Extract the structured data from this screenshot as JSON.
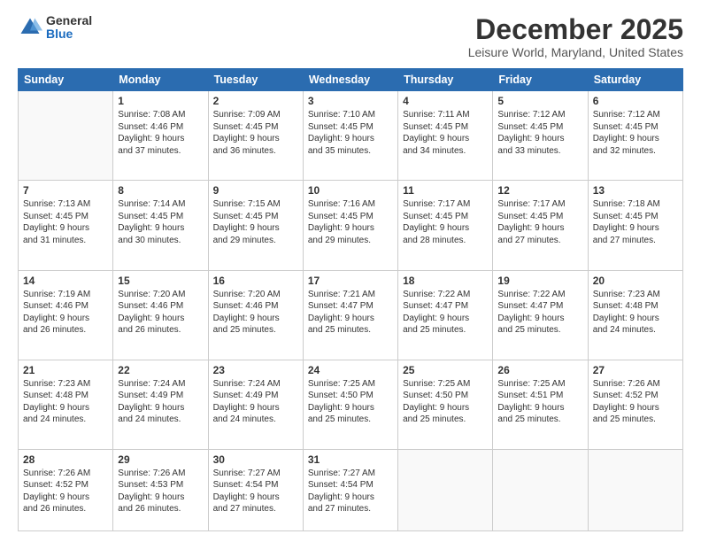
{
  "logo": {
    "general": "General",
    "blue": "Blue"
  },
  "header": {
    "month": "December 2025",
    "location": "Leisure World, Maryland, United States"
  },
  "weekdays": [
    "Sunday",
    "Monday",
    "Tuesday",
    "Wednesday",
    "Thursday",
    "Friday",
    "Saturday"
  ],
  "weeks": [
    [
      {
        "day": "",
        "info": ""
      },
      {
        "day": "1",
        "info": "Sunrise: 7:08 AM\nSunset: 4:46 PM\nDaylight: 9 hours\nand 37 minutes."
      },
      {
        "day": "2",
        "info": "Sunrise: 7:09 AM\nSunset: 4:45 PM\nDaylight: 9 hours\nand 36 minutes."
      },
      {
        "day": "3",
        "info": "Sunrise: 7:10 AM\nSunset: 4:45 PM\nDaylight: 9 hours\nand 35 minutes."
      },
      {
        "day": "4",
        "info": "Sunrise: 7:11 AM\nSunset: 4:45 PM\nDaylight: 9 hours\nand 34 minutes."
      },
      {
        "day": "5",
        "info": "Sunrise: 7:12 AM\nSunset: 4:45 PM\nDaylight: 9 hours\nand 33 minutes."
      },
      {
        "day": "6",
        "info": "Sunrise: 7:12 AM\nSunset: 4:45 PM\nDaylight: 9 hours\nand 32 minutes."
      }
    ],
    [
      {
        "day": "7",
        "info": "Sunrise: 7:13 AM\nSunset: 4:45 PM\nDaylight: 9 hours\nand 31 minutes."
      },
      {
        "day": "8",
        "info": "Sunrise: 7:14 AM\nSunset: 4:45 PM\nDaylight: 9 hours\nand 30 minutes."
      },
      {
        "day": "9",
        "info": "Sunrise: 7:15 AM\nSunset: 4:45 PM\nDaylight: 9 hours\nand 29 minutes."
      },
      {
        "day": "10",
        "info": "Sunrise: 7:16 AM\nSunset: 4:45 PM\nDaylight: 9 hours\nand 29 minutes."
      },
      {
        "day": "11",
        "info": "Sunrise: 7:17 AM\nSunset: 4:45 PM\nDaylight: 9 hours\nand 28 minutes."
      },
      {
        "day": "12",
        "info": "Sunrise: 7:17 AM\nSunset: 4:45 PM\nDaylight: 9 hours\nand 27 minutes."
      },
      {
        "day": "13",
        "info": "Sunrise: 7:18 AM\nSunset: 4:45 PM\nDaylight: 9 hours\nand 27 minutes."
      }
    ],
    [
      {
        "day": "14",
        "info": "Sunrise: 7:19 AM\nSunset: 4:46 PM\nDaylight: 9 hours\nand 26 minutes."
      },
      {
        "day": "15",
        "info": "Sunrise: 7:20 AM\nSunset: 4:46 PM\nDaylight: 9 hours\nand 26 minutes."
      },
      {
        "day": "16",
        "info": "Sunrise: 7:20 AM\nSunset: 4:46 PM\nDaylight: 9 hours\nand 25 minutes."
      },
      {
        "day": "17",
        "info": "Sunrise: 7:21 AM\nSunset: 4:47 PM\nDaylight: 9 hours\nand 25 minutes."
      },
      {
        "day": "18",
        "info": "Sunrise: 7:22 AM\nSunset: 4:47 PM\nDaylight: 9 hours\nand 25 minutes."
      },
      {
        "day": "19",
        "info": "Sunrise: 7:22 AM\nSunset: 4:47 PM\nDaylight: 9 hours\nand 25 minutes."
      },
      {
        "day": "20",
        "info": "Sunrise: 7:23 AM\nSunset: 4:48 PM\nDaylight: 9 hours\nand 24 minutes."
      }
    ],
    [
      {
        "day": "21",
        "info": "Sunrise: 7:23 AM\nSunset: 4:48 PM\nDaylight: 9 hours\nand 24 minutes."
      },
      {
        "day": "22",
        "info": "Sunrise: 7:24 AM\nSunset: 4:49 PM\nDaylight: 9 hours\nand 24 minutes."
      },
      {
        "day": "23",
        "info": "Sunrise: 7:24 AM\nSunset: 4:49 PM\nDaylight: 9 hours\nand 24 minutes."
      },
      {
        "day": "24",
        "info": "Sunrise: 7:25 AM\nSunset: 4:50 PM\nDaylight: 9 hours\nand 25 minutes."
      },
      {
        "day": "25",
        "info": "Sunrise: 7:25 AM\nSunset: 4:50 PM\nDaylight: 9 hours\nand 25 minutes."
      },
      {
        "day": "26",
        "info": "Sunrise: 7:25 AM\nSunset: 4:51 PM\nDaylight: 9 hours\nand 25 minutes."
      },
      {
        "day": "27",
        "info": "Sunrise: 7:26 AM\nSunset: 4:52 PM\nDaylight: 9 hours\nand 25 minutes."
      }
    ],
    [
      {
        "day": "28",
        "info": "Sunrise: 7:26 AM\nSunset: 4:52 PM\nDaylight: 9 hours\nand 26 minutes."
      },
      {
        "day": "29",
        "info": "Sunrise: 7:26 AM\nSunset: 4:53 PM\nDaylight: 9 hours\nand 26 minutes."
      },
      {
        "day": "30",
        "info": "Sunrise: 7:27 AM\nSunset: 4:54 PM\nDaylight: 9 hours\nand 27 minutes."
      },
      {
        "day": "31",
        "info": "Sunrise: 7:27 AM\nSunset: 4:54 PM\nDaylight: 9 hours\nand 27 minutes."
      },
      {
        "day": "",
        "info": ""
      },
      {
        "day": "",
        "info": ""
      },
      {
        "day": "",
        "info": ""
      }
    ]
  ]
}
